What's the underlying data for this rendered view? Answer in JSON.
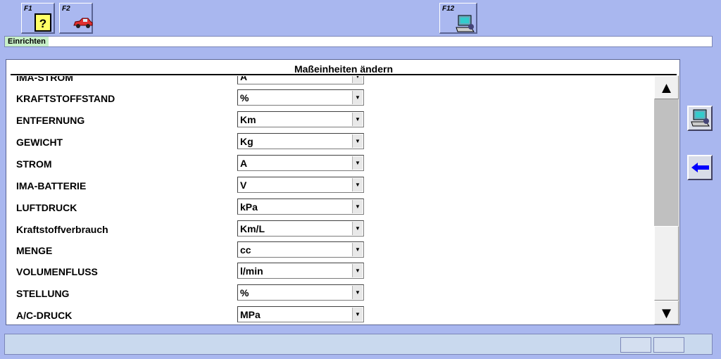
{
  "toolbar": {
    "f1": {
      "key": "F1",
      "icon": "help-icon"
    },
    "f2": {
      "key": "F2",
      "icon": "car-icon"
    },
    "f12": {
      "key": "F12",
      "icon": "computer-icon"
    }
  },
  "status": {
    "title": "Einrichten"
  },
  "panel": {
    "title": "Maßeinheiten ändern",
    "rows": [
      {
        "label": "IMA-STROM",
        "value": "A"
      },
      {
        "label": "KRAFTSTOFFSTAND",
        "value": "%"
      },
      {
        "label": "ENTFERNUNG",
        "value": "Km"
      },
      {
        "label": "GEWICHT",
        "value": "Kg"
      },
      {
        "label": "STROM",
        "value": "A"
      },
      {
        "label": "IMA-BATTERIE",
        "value": "V"
      },
      {
        "label": "LUFTDRUCK",
        "value": "kPa"
      },
      {
        "label": "Kraftstoffverbrauch",
        "value": "Km/L"
      },
      {
        "label": "MENGE",
        "value": "cc"
      },
      {
        "label": "VOLUMENFLUSS",
        "value": "l/min"
      },
      {
        "label": "STELLUNG",
        "value": "%"
      },
      {
        "label": "A/C-DRUCK",
        "value": "MPa"
      }
    ]
  },
  "side": {
    "computer_icon": "computer-icon",
    "back_icon": "arrow-left-icon"
  },
  "colors": {
    "background": "#a9b7ef",
    "accent_blue": "#0000ff"
  }
}
